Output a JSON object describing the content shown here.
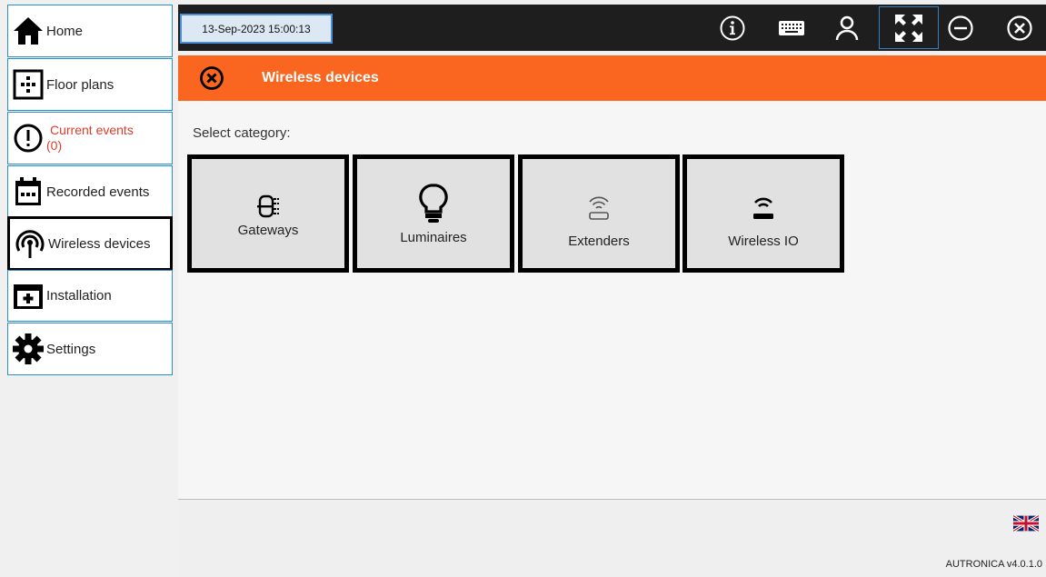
{
  "sidebar": {
    "items": [
      {
        "label": "Home",
        "icon": "home-icon"
      },
      {
        "label": "Floor plans",
        "icon": "floor-plan-icon"
      },
      {
        "label": "Current events",
        "count": "(0)",
        "icon": "alert-icon"
      },
      {
        "label": "Recorded events",
        "icon": "calendar-icon"
      },
      {
        "label": "Wireless devices",
        "icon": "wireless-icon"
      },
      {
        "label": "Installation",
        "icon": "installation-icon"
      },
      {
        "label": "Settings",
        "icon": "gear-icon"
      }
    ],
    "active": "Wireless devices",
    "alert_color": "#e23b2a"
  },
  "topbar": {
    "datetime": "13-Sep-2023 15:00:13",
    "buttons": [
      "info-icon",
      "keyboard-icon",
      "user-icon",
      "fullscreen-icon",
      "minimize-icon",
      "close-icon"
    ]
  },
  "header": {
    "title": "Wireless devices",
    "color": "#fa6520"
  },
  "main": {
    "select_label": "Select category:",
    "categories": [
      {
        "label": "Gateways",
        "icon": "gateway-icon"
      },
      {
        "label": "Luminaires",
        "icon": "bulb-icon"
      },
      {
        "label": "Extenders",
        "icon": "extender-icon"
      },
      {
        "label": "Wireless IO",
        "icon": "wireless-io-icon"
      }
    ]
  },
  "footer": {
    "language": "UK flag",
    "version": "AUTRONICA v4.0.1.0"
  }
}
